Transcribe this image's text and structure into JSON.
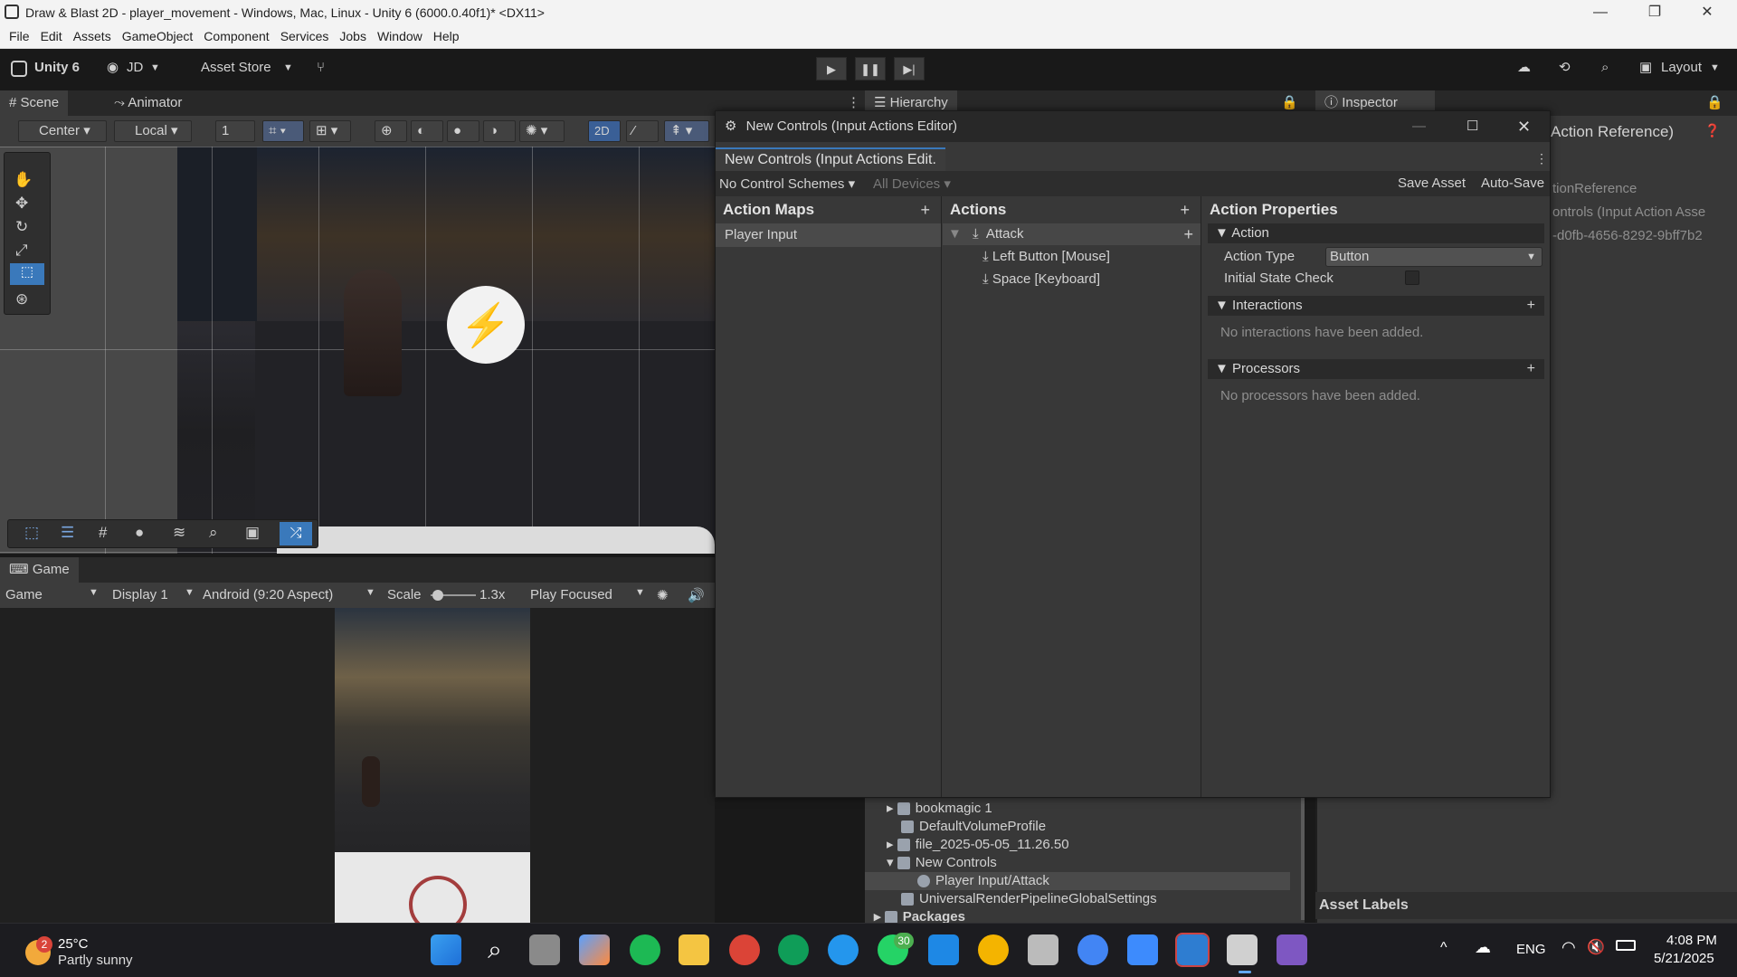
{
  "window": {
    "title": "Draw & Blast 2D - player_movement - Windows, Mac, Linux - Unity 6 (6000.0.40f1)* <DX11>",
    "minimize": "—",
    "restore": "❐",
    "close": "✕"
  },
  "menu": [
    "File",
    "Edit",
    "Assets",
    "GameObject",
    "Component",
    "Services",
    "Jobs",
    "Window",
    "Help"
  ],
  "toolbar": {
    "unity_label": "Unity 6",
    "account": "JD",
    "asset_store": "Asset Store",
    "layout": "Layout"
  },
  "scene": {
    "tab_scene": "Scene",
    "tab_animator": "Animator",
    "pivot": "Center",
    "space": "Local",
    "grid_size": "1",
    "mode_2d": "2D"
  },
  "game": {
    "tab": "Game",
    "view": "Game",
    "display": "Display 1",
    "aspect": "Android (9:20 Aspect)",
    "scale_label": "Scale",
    "scale_value": "1.3x",
    "play_mode": "Play Focused"
  },
  "hierarchy": {
    "tab": "Hierarchy"
  },
  "inspector": {
    "tab": "Inspector",
    "header": "Action Reference)",
    "row1": "tionReference",
    "row2": "ontrols (Input Action Asse",
    "row3": "-d0fb-4656-8292-9bff7b2",
    "asset_labels": "Asset Labels"
  },
  "editor": {
    "title": "New Controls (Input Actions Editor)",
    "tab": "New Controls (Input Actions Edit.",
    "schemes": "No Control Schemes",
    "devices": "All Devices",
    "save_asset": "Save Asset",
    "auto_save": "Auto-Save",
    "action_maps_header": "Action Maps",
    "action_maps": [
      "Player Input"
    ],
    "actions_header": "Actions",
    "action": "Attack",
    "bindings": [
      "Left Button [Mouse]",
      "Space [Keyboard]"
    ],
    "props_header": "Action Properties",
    "section_action": "Action",
    "action_type_label": "Action Type",
    "action_type_value": "Button",
    "initial_state_label": "Initial State Check",
    "section_interactions": "Interactions",
    "interactions_empty": "No interactions have been added.",
    "section_processors": "Processors",
    "processors_empty": "No processors have been added."
  },
  "project": {
    "items": [
      "bookmagic 1",
      "DefaultVolumeProfile",
      "file_2025-05-05_11.26.50",
      "New Controls",
      "Player Input/Attack",
      "UniversalRenderPipelineGlobalSettings",
      "Packages"
    ]
  },
  "taskbar": {
    "weather_temp": "25°C",
    "weather_desc": "Partly sunny",
    "weather_badge": "2",
    "whatsapp_badge": "30",
    "lang": "ENG",
    "time": "4:08 PM",
    "date": "5/21/2025"
  }
}
